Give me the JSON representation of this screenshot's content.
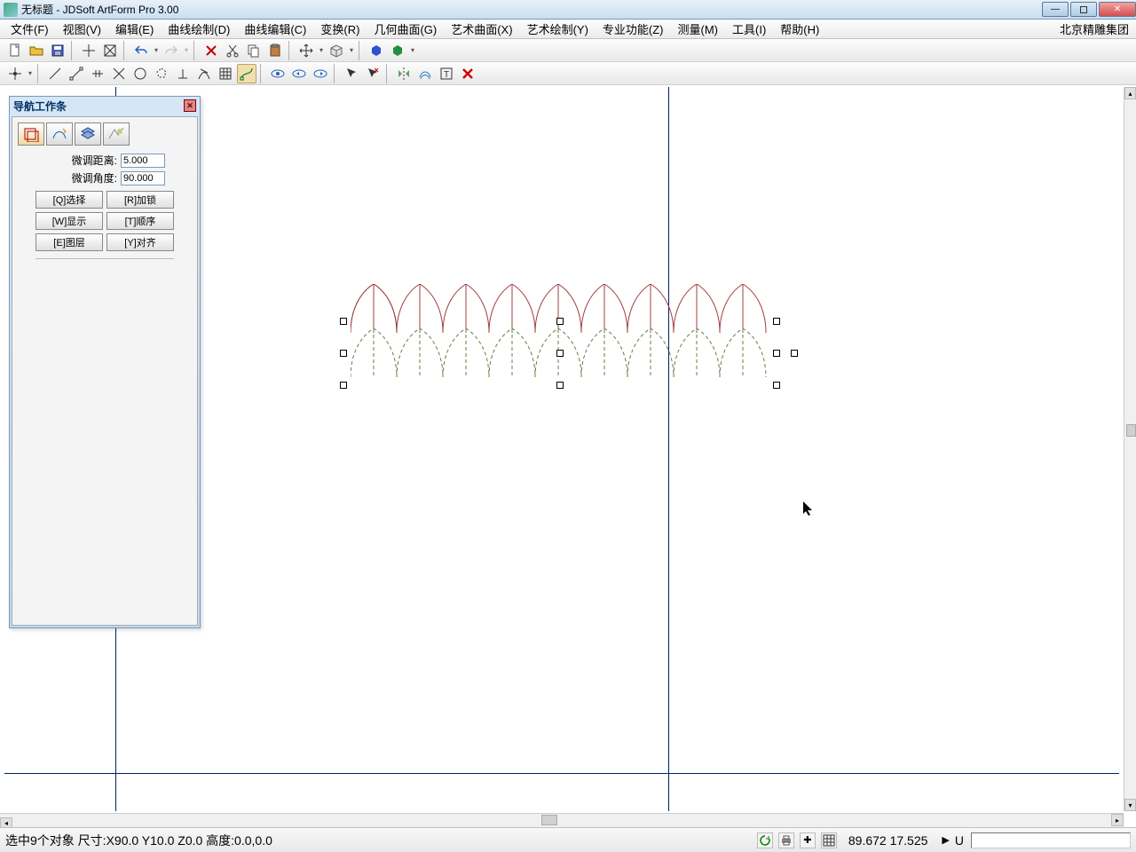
{
  "title": "无标题 - JDSoft ArtForm Pro 3.00",
  "brand": "北京精雕集团",
  "menu": {
    "file": "文件(F)",
    "view": "视图(V)",
    "edit": "编辑(E)",
    "curve_draw": "曲线绘制(D)",
    "curve_edit": "曲线编辑(C)",
    "transform": "变换(R)",
    "geo_surface": "几何曲面(G)",
    "art_surface": "艺术曲面(X)",
    "art_draw": "艺术绘制(Y)",
    "pro": "专业功能(Z)",
    "measure": "测量(M)",
    "tools": "工具(I)",
    "help": "帮助(H)"
  },
  "panel": {
    "title": "导航工作条",
    "dist_label": "微调距离:",
    "dist_value": "5.000",
    "angle_label": "微调角度:",
    "angle_value": "90.000",
    "btn_select": "[Q]选择",
    "btn_lock": "[R]加锁",
    "btn_display": "[W]显示",
    "btn_order": "[T]顺序",
    "btn_layer": "[E]图层",
    "btn_align": "[Y]对齐"
  },
  "status": {
    "left": "选中9个对象 尺寸:X90.0 Y10.0 Z0.0 高度:0.0,0.0",
    "coords": "89.672 17.525",
    "u": "U"
  },
  "palette_colors": [
    "#ff0000",
    "#ffff00",
    "#0000ff",
    "#00ff00",
    "#ff00ff",
    "#ffffff",
    "#000000",
    "#ff8000",
    "#008000",
    "#004040",
    "#008080",
    "#004060",
    "#209060",
    "#808080",
    "#c0c0c0",
    "#60ff60",
    "#00ffc0",
    "#00c0c0",
    "#60c0ff",
    "#600080",
    "#800080",
    "#ffc0e0",
    "#ffe080",
    "#804020",
    "#002080",
    "#c0a080",
    "#802020",
    "#40ff80"
  ]
}
